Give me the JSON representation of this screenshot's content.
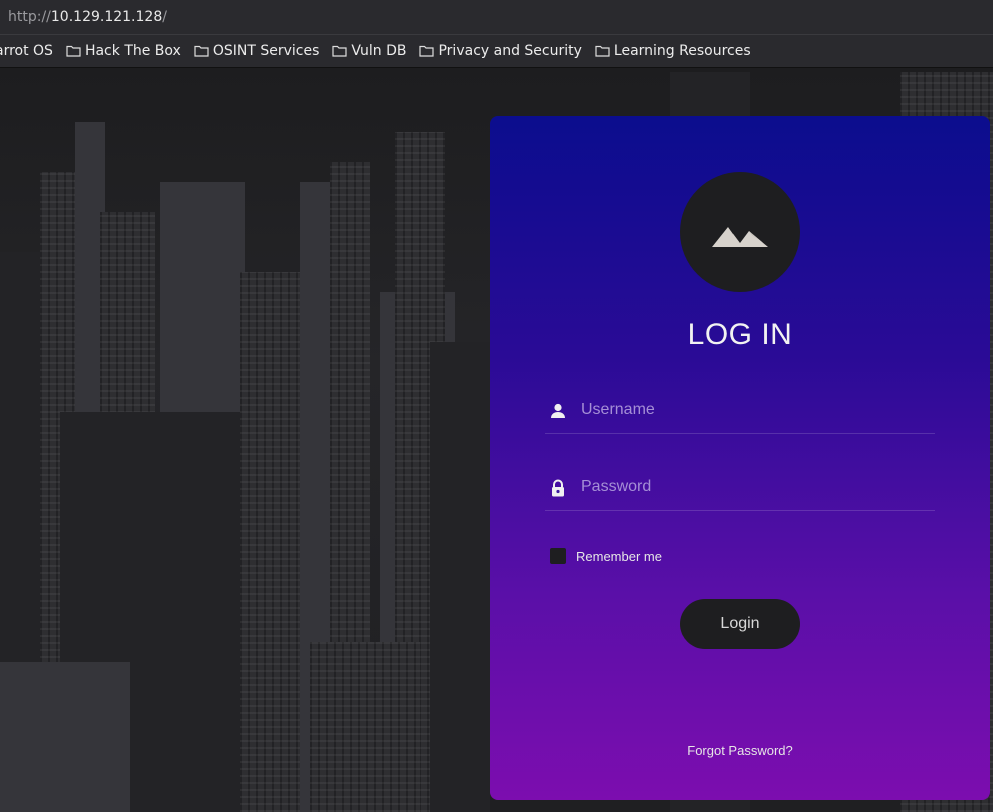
{
  "browser": {
    "url_prefix": "http://",
    "url_host": "10.129.121.128",
    "url_suffix": "/"
  },
  "bookmarks": [
    {
      "label": "arrot OS",
      "icon": "folder-icon"
    },
    {
      "label": "Hack The Box",
      "icon": "folder-icon"
    },
    {
      "label": "OSINT Services",
      "icon": "folder-icon"
    },
    {
      "label": "Vuln DB",
      "icon": "folder-icon"
    },
    {
      "label": "Privacy and Security",
      "icon": "folder-icon"
    },
    {
      "label": "Learning Resources",
      "icon": "folder-icon"
    }
  ],
  "login": {
    "logo_icon": "mountain-icon",
    "title": "LOG IN",
    "username_placeholder": "Username",
    "username_value": "",
    "password_placeholder": "Password",
    "password_value": "",
    "remember_label": "Remember me",
    "remember_checked": false,
    "login_button": "Login",
    "forgot_link": "Forgot Password?"
  },
  "colors": {
    "card_top": "#0b0d8e",
    "card_bottom": "#7c0daf",
    "button_bg": "#1e1e20"
  }
}
